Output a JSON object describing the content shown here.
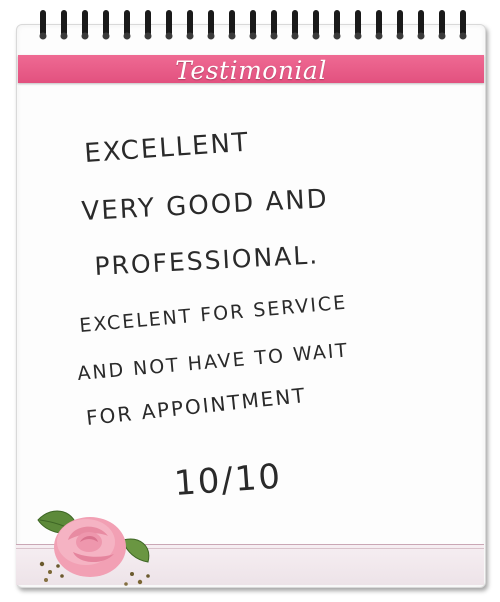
{
  "header": {
    "title": "Testimonial"
  },
  "note": {
    "lines": [
      "EXCELLENT",
      "VERY GOOD AND",
      "PROFESSIONAL.",
      "EXCELENT FOR SERVICE",
      "AND NOT HAVE TO WAIT",
      "FOR APPOINTMENT",
      "10/10"
    ]
  },
  "colors": {
    "ribbon": "#e85a87",
    "spiral": "#1a1a1a",
    "ink": "#2a2a2a",
    "rose": "#f4a6b8",
    "leaf": "#5d8a3a"
  },
  "icons": {
    "spiral": "spiral-binding-icon",
    "rose": "rose-icon"
  }
}
